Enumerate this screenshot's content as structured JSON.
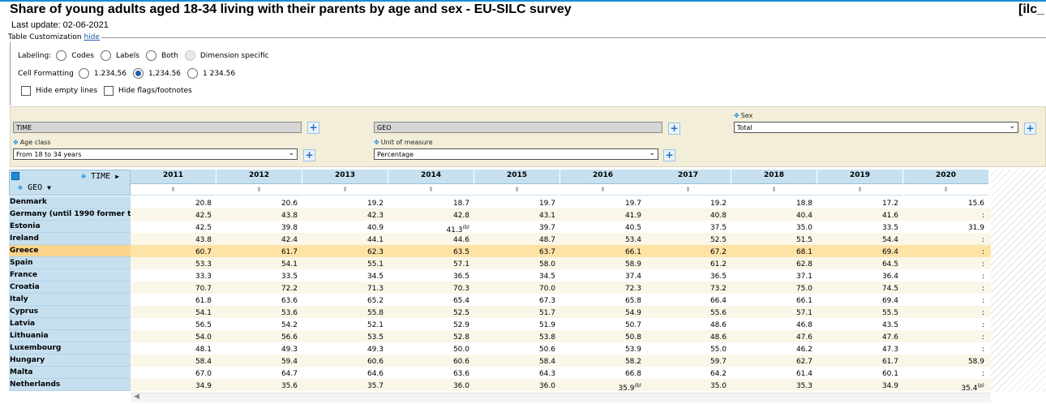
{
  "title": "Share of young adults aged 18-34 living with their parents by age and sex - EU-SILC survey",
  "code": "[ilc_",
  "last_update": "Last update: 02-06-2021",
  "customization": {
    "legend": "Table Customization",
    "hide_link": "hide",
    "labeling_label": "Labeling:",
    "labeling_options": [
      "Codes",
      "Labels",
      "Both",
      "Dimension specific"
    ],
    "cell_formatting_label": "Cell Formatting",
    "cell_formatting_options": [
      "1.234,56",
      "1,234.56",
      "1 234.56"
    ],
    "hide_empty_lines": "Hide empty lines",
    "hide_flags": "Hide flags/footnotes"
  },
  "dimensions": {
    "time_box": "TIME",
    "geo_box": "GEO",
    "sex_label": "Sex",
    "sex_value": "Total",
    "age_label": "Age class",
    "age_value": "From 18 to 34 years",
    "unit_label": "Unit of measure",
    "unit_value": "Percentage"
  },
  "table": {
    "time_header": "TIME",
    "geo_header": "GEO",
    "years": [
      "2011",
      "2012",
      "2013",
      "2014",
      "2015",
      "2016",
      "2017",
      "2018",
      "2019",
      "2020"
    ],
    "rows": [
      {
        "geo": "Denmark",
        "values": [
          "20.8",
          "20.6",
          "19.2",
          "18.7",
          "19.7",
          "19.7",
          "19.2",
          "18.8",
          "17.2",
          "15.6"
        ],
        "flags": [
          "",
          "",
          "",
          "",
          "",
          "",
          "",
          "",
          "",
          ""
        ]
      },
      {
        "geo": "Germany (until 1990 former t",
        "values": [
          "42.5",
          "43.8",
          "42.3",
          "42.8",
          "43.1",
          "41.9",
          "40.8",
          "40.4",
          "41.6",
          ":"
        ],
        "flags": [
          "",
          "",
          "",
          "",
          "",
          "",
          "",
          "",
          "",
          ""
        ]
      },
      {
        "geo": "Estonia",
        "values": [
          "42.5",
          "39.8",
          "40.9",
          "41.3",
          "39.7",
          "40.5",
          "37.5",
          "35.0",
          "33.5",
          "31.9"
        ],
        "flags": [
          "",
          "",
          "",
          "(b)",
          "",
          "",
          "",
          "",
          "",
          ""
        ]
      },
      {
        "geo": "Ireland",
        "values": [
          "43.8",
          "42.4",
          "44.1",
          "44.6",
          "48.7",
          "53.4",
          "52.5",
          "51.5",
          "54.4",
          ":"
        ],
        "flags": [
          "",
          "",
          "",
          "",
          "",
          "",
          "",
          "",
          "",
          ""
        ]
      },
      {
        "geo": "Greece",
        "values": [
          "60.7",
          "61.7",
          "62.3",
          "63.5",
          "63.7",
          "66.1",
          "67.2",
          "68.1",
          "69.4",
          ":"
        ],
        "flags": [
          "",
          "",
          "",
          "",
          "",
          "",
          "",
          "",
          "",
          ""
        ]
      },
      {
        "geo": "Spain",
        "values": [
          "53.3",
          "54.1",
          "55.1",
          "57.1",
          "58.0",
          "58.9",
          "61.2",
          "62.8",
          "64.5",
          ":"
        ],
        "flags": [
          "",
          "",
          "",
          "",
          "",
          "",
          "",
          "",
          "",
          ""
        ]
      },
      {
        "geo": "France",
        "values": [
          "33.3",
          "33.5",
          "34.5",
          "36.5",
          "34.5",
          "37.4",
          "36.5",
          "37.1",
          "36.4",
          ":"
        ],
        "flags": [
          "",
          "",
          "",
          "",
          "",
          "",
          "",
          "",
          "",
          ""
        ]
      },
      {
        "geo": "Croatia",
        "values": [
          "70.7",
          "72.2",
          "71.3",
          "70.3",
          "70.0",
          "72.3",
          "73.2",
          "75.0",
          "74.5",
          ":"
        ],
        "flags": [
          "",
          "",
          "",
          "",
          "",
          "",
          "",
          "",
          "",
          ""
        ]
      },
      {
        "geo": "Italy",
        "values": [
          "61.8",
          "63.6",
          "65.2",
          "65.4",
          "67.3",
          "65.8",
          "66.4",
          "66.1",
          "69.4",
          ":"
        ],
        "flags": [
          "",
          "",
          "",
          "",
          "",
          "",
          "",
          "",
          "",
          ""
        ]
      },
      {
        "geo": "Cyprus",
        "values": [
          "54.1",
          "53.6",
          "55.8",
          "52.5",
          "51.7",
          "54.9",
          "55.6",
          "57.1",
          "55.5",
          ":"
        ],
        "flags": [
          "",
          "",
          "",
          "",
          "",
          "",
          "",
          "",
          "",
          ""
        ]
      },
      {
        "geo": "Latvia",
        "values": [
          "56.5",
          "54.2",
          "52.1",
          "52.9",
          "51.9",
          "50.7",
          "48.6",
          "46.8",
          "43.5",
          ":"
        ],
        "flags": [
          "",
          "",
          "",
          "",
          "",
          "",
          "",
          "",
          "",
          ""
        ]
      },
      {
        "geo": "Lithuania",
        "values": [
          "54.0",
          "56.6",
          "53.5",
          "52.8",
          "53.8",
          "50.8",
          "48.6",
          "47.6",
          "47.6",
          ":"
        ],
        "flags": [
          "",
          "",
          "",
          "",
          "",
          "",
          "",
          "",
          "",
          ""
        ]
      },
      {
        "geo": "Luxembourg",
        "values": [
          "48.1",
          "49.3",
          "49.3",
          "50.0",
          "50.6",
          "53.9",
          "55.0",
          "46.2",
          "47.3",
          ":"
        ],
        "flags": [
          "",
          "",
          "",
          "",
          "",
          "",
          "",
          "",
          "",
          ""
        ]
      },
      {
        "geo": "Hungary",
        "values": [
          "58.4",
          "59.4",
          "60.6",
          "60.6",
          "58.4",
          "58.2",
          "59.7",
          "62.7",
          "61.7",
          "58.9"
        ],
        "flags": [
          "",
          "",
          "",
          "",
          "",
          "",
          "",
          "",
          "",
          ""
        ]
      },
      {
        "geo": "Malta",
        "values": [
          "67.0",
          "64.7",
          "64.6",
          "63.6",
          "64.3",
          "66.8",
          "64.2",
          "61.4",
          "60.1",
          ":"
        ],
        "flags": [
          "",
          "",
          "",
          "",
          "",
          "",
          "",
          "",
          "",
          ""
        ]
      },
      {
        "geo": "Netherlands",
        "values": [
          "34.9",
          "35.6",
          "35.7",
          "36.0",
          "36.0",
          "35.9",
          "35.0",
          "35.3",
          "34.9",
          "35.4"
        ],
        "flags": [
          "",
          "",
          "",
          "",
          "",
          "(b)",
          "",
          "",
          "",
          "(p)"
        ]
      }
    ],
    "highlighted_row": "Greece"
  }
}
